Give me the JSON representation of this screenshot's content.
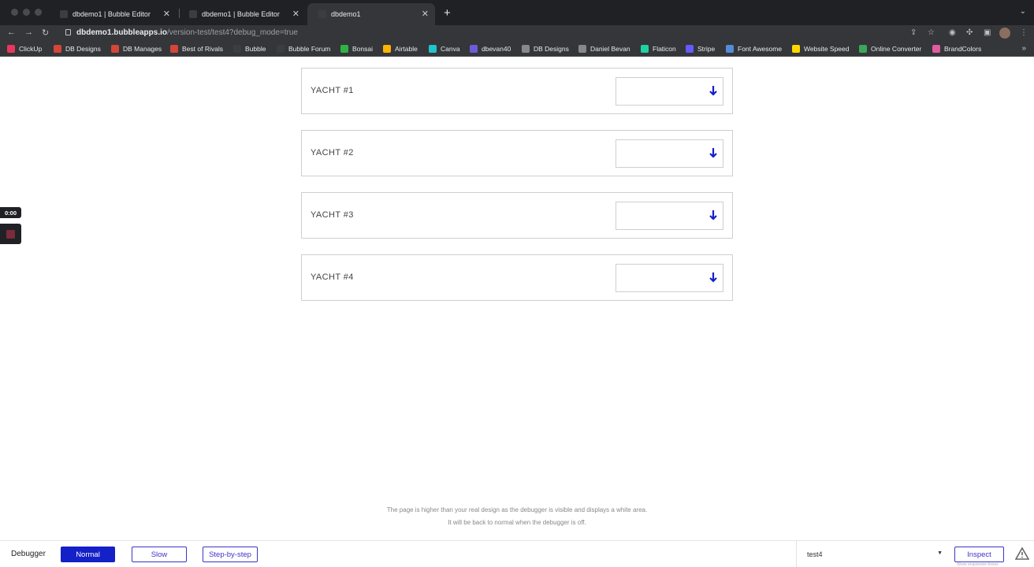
{
  "browser": {
    "tabs": [
      {
        "title": "dbdemo1 | Bubble Editor",
        "close": "✕"
      },
      {
        "title": "dbdemo1 | Bubble Editor",
        "close": "✕"
      },
      {
        "title": "dbdemo1",
        "close": "✕"
      }
    ],
    "new_tab": "+",
    "url_host": "dbdemo1.bubbleapps.io",
    "url_path": "/version-test/test4?debug_mode=true",
    "bookmarks": [
      {
        "label": "ClickUp",
        "color": "#e8375f"
      },
      {
        "label": "DB Designs",
        "color": "#d44638"
      },
      {
        "label": "DB Manages",
        "color": "#d44638"
      },
      {
        "label": "Best of Rivals",
        "color": "#d44638"
      },
      {
        "label": "Bubble",
        "color": "#3c3d40"
      },
      {
        "label": "Bubble Forum",
        "color": "#3c3d40"
      },
      {
        "label": "Bonsai",
        "color": "#2fb344"
      },
      {
        "label": "Airtable",
        "color": "#fcb400"
      },
      {
        "label": "Canva",
        "color": "#20c4cb"
      },
      {
        "label": "dbevan40",
        "color": "#6e5bd8"
      },
      {
        "label": "DB Designs",
        "color": "#888888"
      },
      {
        "label": "Daniel Bevan",
        "color": "#888888"
      },
      {
        "label": "Flaticon",
        "color": "#1fd1a3"
      },
      {
        "label": "Stripe",
        "color": "#635bff"
      },
      {
        "label": "Font Awesome",
        "color": "#538dd7"
      },
      {
        "label": "Website Speed",
        "color": "#ffd700"
      },
      {
        "label": "Online Converter",
        "color": "#3aa757"
      },
      {
        "label": "BrandColors",
        "color": "#e05ca0"
      }
    ]
  },
  "recorder": {
    "timer": "0:00"
  },
  "yachts": [
    {
      "label": "YACHT #1"
    },
    {
      "label": "YACHT #2"
    },
    {
      "label": "YACHT #3"
    },
    {
      "label": "YACHT #4"
    }
  ],
  "notice": {
    "line1": "The page is higher than your real design as the debugger is visible and displays a white area.",
    "line2": "It will be back to normal when the debugger is off."
  },
  "debugger": {
    "title": "Debugger",
    "modes": [
      {
        "label": "Normal",
        "active": true
      },
      {
        "label": "Slow",
        "active": false
      },
      {
        "label": "Step-by-step",
        "active": false
      }
    ],
    "page_value": "test4",
    "inspect_label": "Inspect",
    "tiny_text": "Show responsive boxes",
    "accent_color": "#1420c8"
  }
}
